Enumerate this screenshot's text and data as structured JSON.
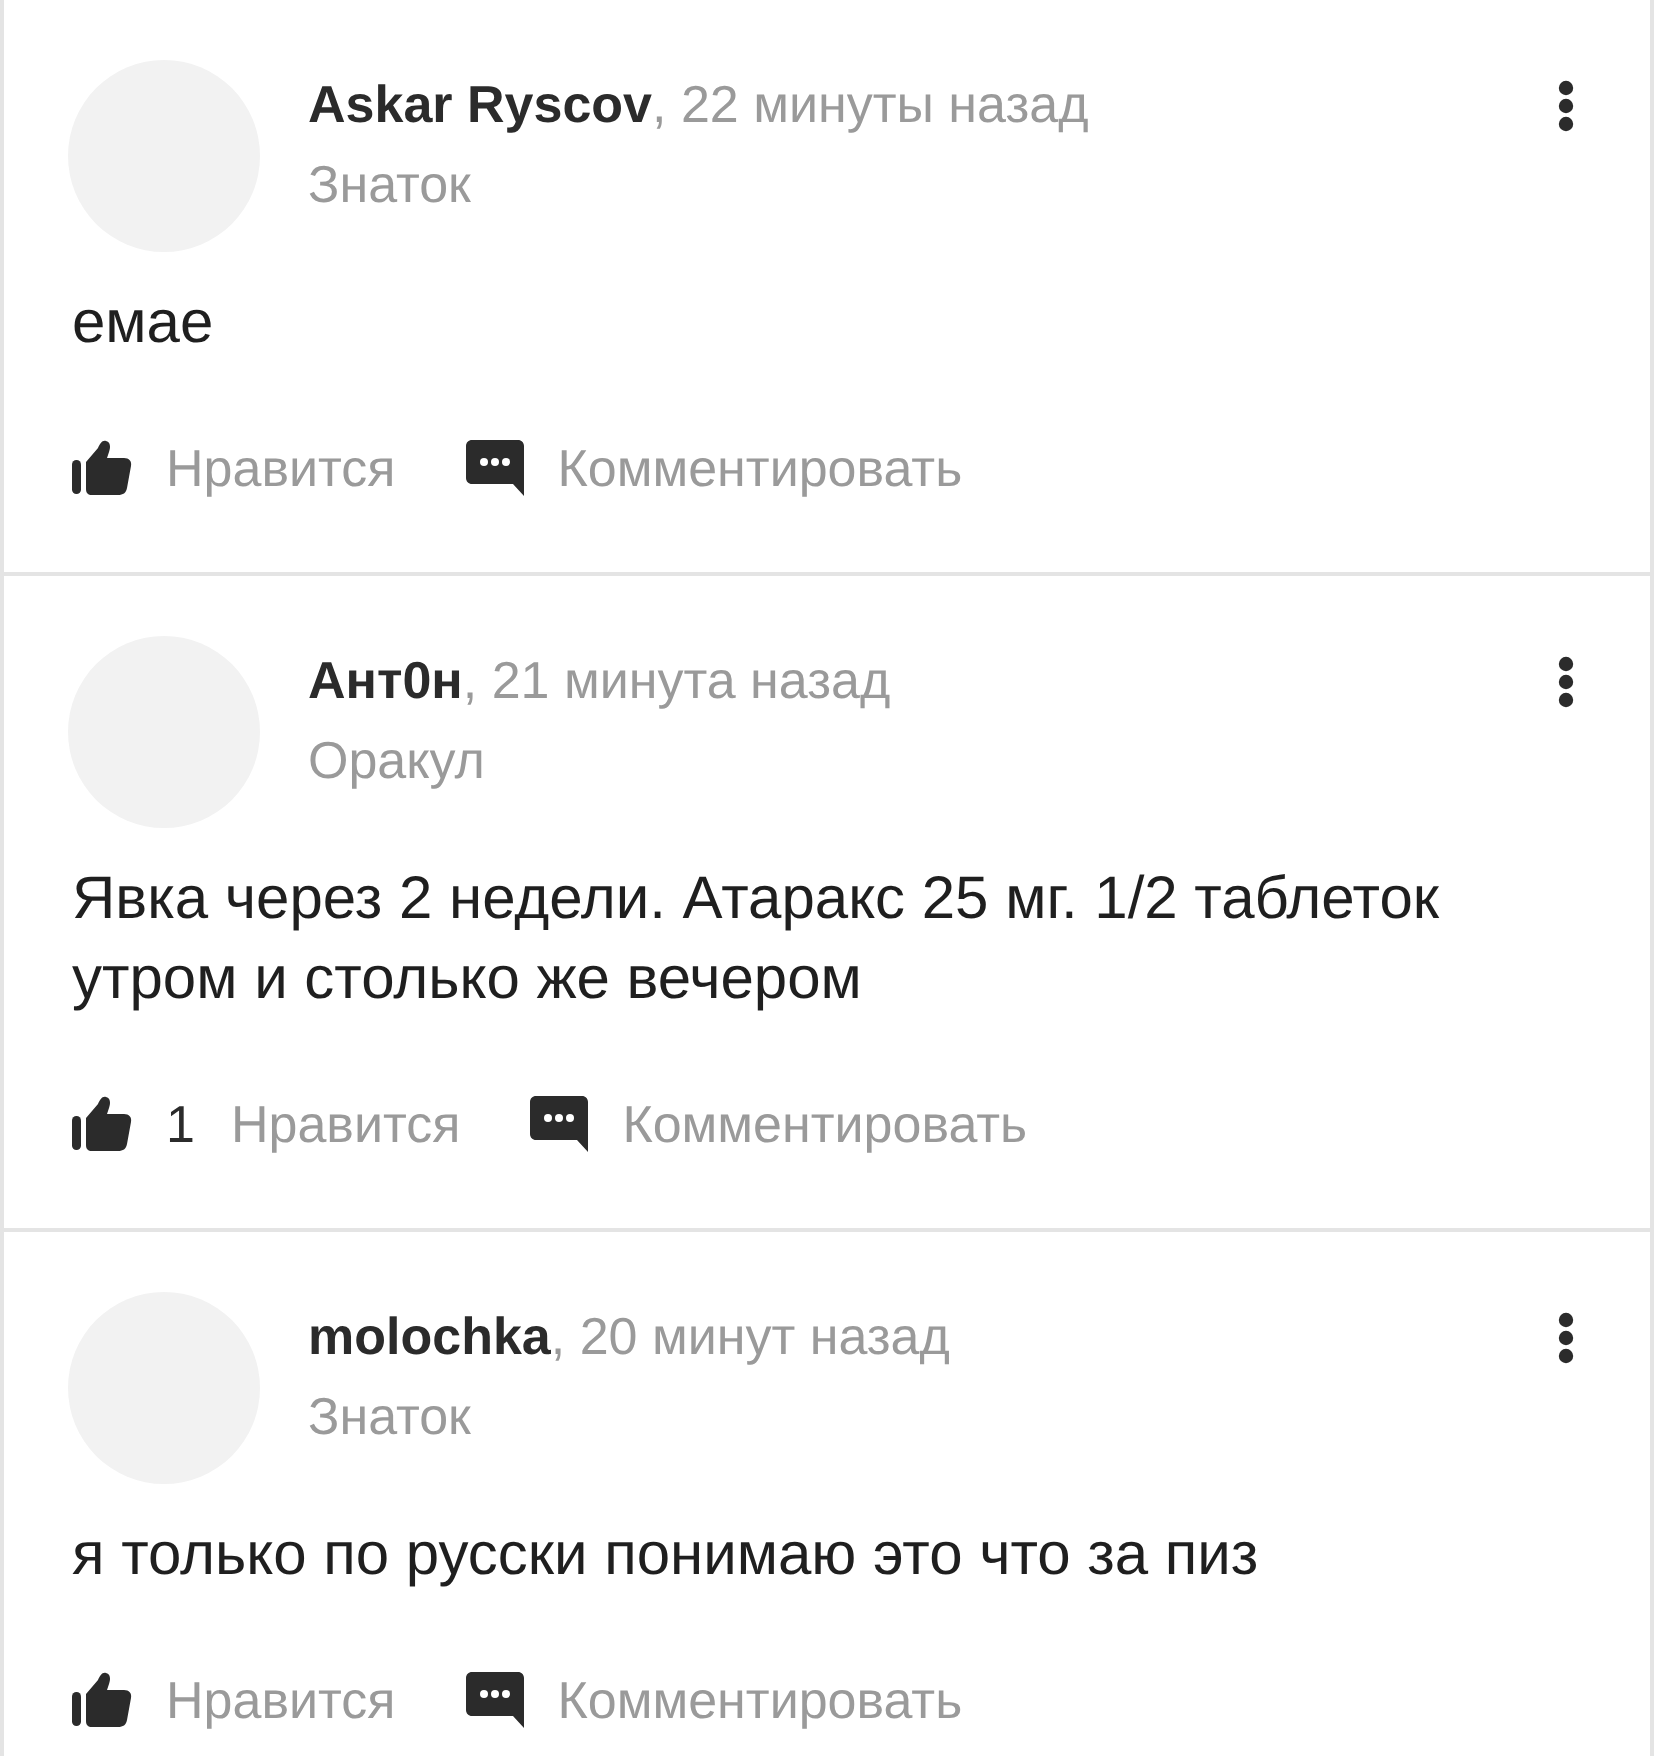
{
  "comments": [
    {
      "author": "Askar Ryscov",
      "time": ", 22 минуты назад",
      "rank": "Знаток",
      "text": "емае",
      "actions": [
        {
          "kind": "like",
          "label": "Нравится"
        },
        {
          "kind": "comment",
          "label": "Комментировать"
        }
      ]
    },
    {
      "author": "Ант0н",
      "time": ", 21 минута назад",
      "rank": "Оракул",
      "text": "Явка через 2 недели. Атаракс 25 мг. 1/2 таблеток утром и столько же вечером",
      "actions": [
        {
          "kind": "like",
          "count": "1",
          "label": "Нравится"
        },
        {
          "kind": "comment",
          "label": "Комментировать"
        }
      ]
    },
    {
      "author": "molochka",
      "time": ", 20 минут назад",
      "rank": "Знаток",
      "text": "я только по русски понимаю это что за пиз",
      "actions": [
        {
          "kind": "like",
          "label": "Нравится"
        },
        {
          "kind": "comment",
          "label": "Комментировать"
        }
      ]
    }
  ]
}
